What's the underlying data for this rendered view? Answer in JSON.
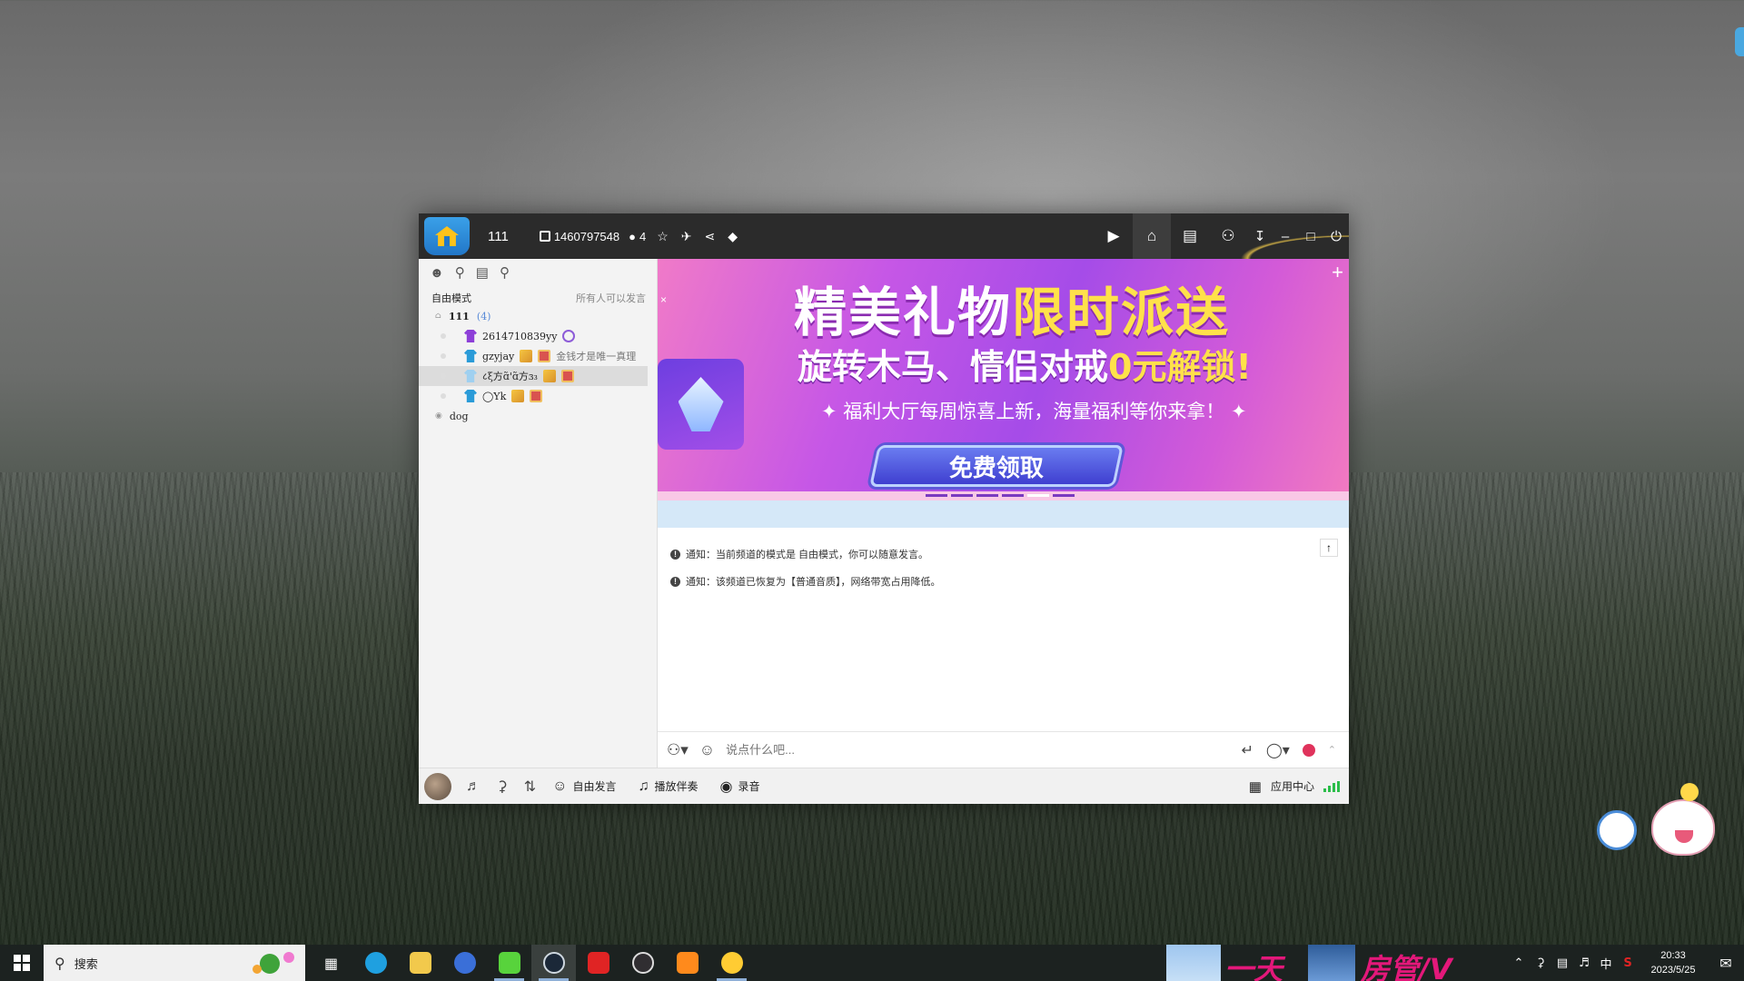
{
  "window": {
    "room_name": "111",
    "room_id": "1460797548",
    "user_count": "4",
    "tool_icons": [
      "star-icon",
      "plane-icon",
      "share-icon",
      "shield-icon"
    ],
    "right_icons": [
      "video-icon",
      "home-icon",
      "list-icon",
      "gamepad-icon"
    ]
  },
  "sidebar": {
    "mode": "自由模式",
    "permission": "所有人可以发言",
    "channels": [
      {
        "name": "111",
        "count": "(4)"
      },
      {
        "name": "dog"
      }
    ],
    "users": [
      {
        "name": "2614710839yy",
        "signature": "",
        "shirt_color": "#8d3fd8"
      },
      {
        "name": "gzyjay",
        "signature": "金钱才是唯一真理",
        "shirt_color": "#2a9bd8"
      },
      {
        "name": "८ξ方ɑ̃'ɑ̃方ɜ₃",
        "signature": "",
        "shirt_color": "#9fd0f0"
      },
      {
        "name": "◯Yk",
        "signature": "",
        "shirt_color": "#2a9bd8"
      }
    ]
  },
  "banner": {
    "line1_a": "精美礼物",
    "line1_b": "限时派送",
    "line2_a": "旋转木马、情侣对戒",
    "line2_b": "0元解锁!",
    "line3": "福利大厅每周惊喜上新，海量福利等你来拿！",
    "cta": "免费领取"
  },
  "notices": [
    "通知：当前频道的模式是 自由模式，你可以随意发言。",
    "通知：该频道已恢复为【普通音质】，网络带宽占用降低。"
  ],
  "input": {
    "placeholder": "说点什么吧..."
  },
  "bottombar": {
    "free_speak": "自由发言",
    "play_music": "播放伴奏",
    "record": "录音",
    "app_center": "应用中心"
  },
  "taskbar": {
    "search_text": "搜索",
    "apps": [
      {
        "name": "task-view",
        "color": "#1c2220"
      },
      {
        "name": "edge",
        "color": "#1fa0e0"
      },
      {
        "name": "file-explorer",
        "color": "#f2c94c"
      },
      {
        "name": "m-app",
        "color": "#3a6fd8"
      },
      {
        "name": "kook",
        "color": "#58d33c"
      },
      {
        "name": "steam",
        "color": "#1b2838"
      },
      {
        "name": "netease-music",
        "color": "#e02424"
      },
      {
        "name": "obs",
        "color": "#302e31"
      },
      {
        "name": "orange-app",
        "color": "#ff8a1c"
      },
      {
        "name": "yy-app",
        "color": "#ffcc33"
      }
    ],
    "banner_text1": "一天",
    "banner_text2": "房管/V",
    "ime": "中",
    "time": "20:33",
    "date": "2023/5/25"
  },
  "colors": {
    "titlebar": "#2b2b2b",
    "accent_gold": "#ffe14a",
    "banner_purple": "#a54ce8",
    "signal_green": "#2bbd4a"
  }
}
